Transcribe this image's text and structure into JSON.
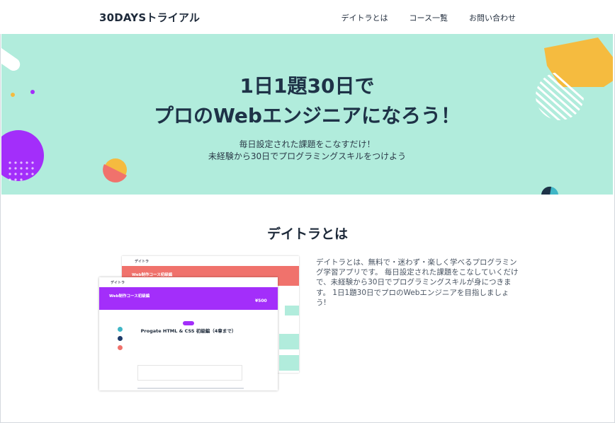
{
  "header": {
    "logo": "30DAYSトライアル",
    "nav": [
      "デイトラとは",
      "コース一覧",
      "お問い合わせ"
    ]
  },
  "hero": {
    "title_line1": "1日1題30日で",
    "title_line2": "プロのWebエンジニアになろう！",
    "sub_line1": "毎日設定された課題をこなすだけ！",
    "sub_line2": "未経験から30日でプログラミングスキルをつけよう"
  },
  "about": {
    "title": "デイトラとは",
    "description": "デイトラとは、無料で・迷わず・楽しく学べるプログラミング学習アプリです。 毎日設定された課題をこなしていくだけで、未経験から30日でプログラミングスキルが身につきます。 1日1題30日でプロのWebエンジニアを目指しましょう!"
  },
  "mock": {
    "back_logo": "デイトラ",
    "back_banner": "Web制作コース初級編",
    "front_logo": "デイトラ",
    "front_banner": "Web制作コース初級編",
    "price": "¥500",
    "lesson_title": "Progate HTML & CSS 初級編（4章まで）"
  },
  "colors": {
    "hero_bg": "#b1ecdc",
    "accent_purple": "#a32efa",
    "accent_coral": "#f0726c",
    "accent_yellow": "#f5bb3f"
  }
}
